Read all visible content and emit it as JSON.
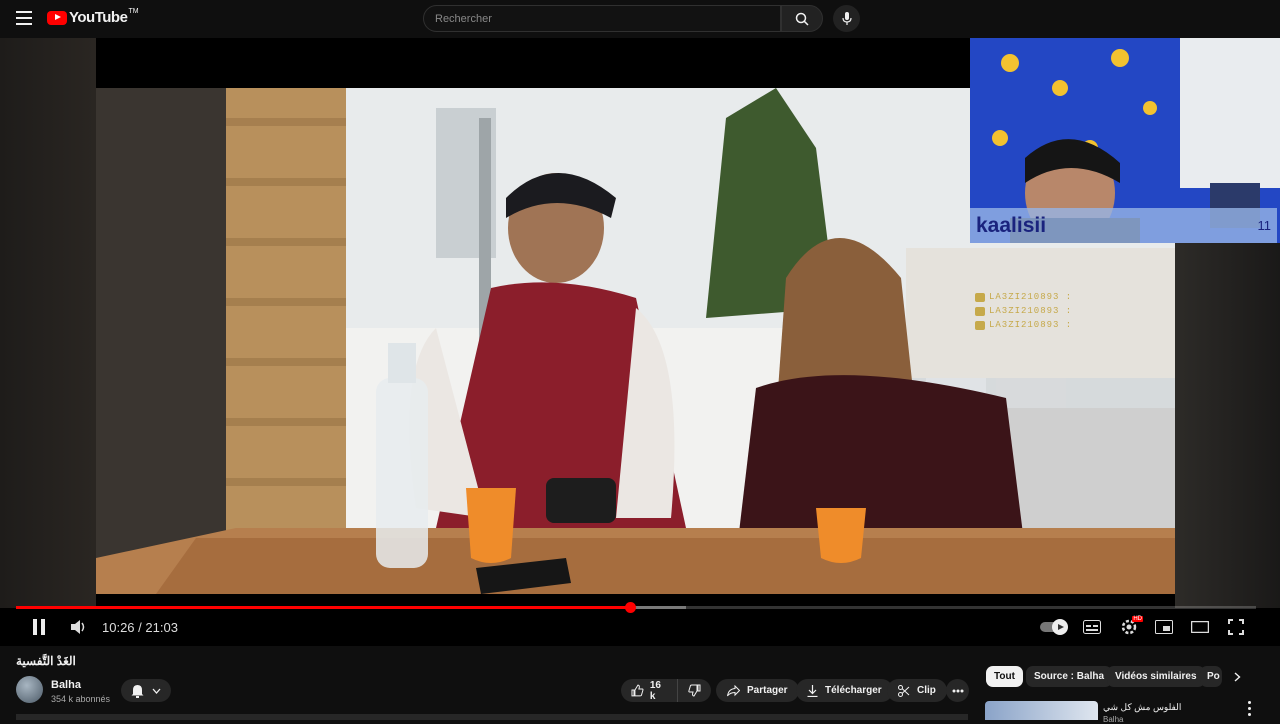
{
  "header": {
    "logo_text": "YouTube",
    "logo_tm": "TM",
    "search_placeholder": "Rechercher"
  },
  "stream_overlay": {
    "streamer_name": "kaalisii",
    "count": "11",
    "chat_lines": [
      "LA3ZI210893 :",
      "LA3ZI210893 :",
      "LA3ZI210893 :"
    ]
  },
  "player": {
    "current_time": "10:26",
    "separator": " / ",
    "duration": "21:03",
    "progress_fraction": 0.495,
    "loaded_fraction": 0.54,
    "hd_badge": "HD"
  },
  "video": {
    "title": "الغَدْ التَّفسية",
    "channel_name": "Balha",
    "subscribers": "354 k abonnés"
  },
  "actions": {
    "likes": "16 k",
    "share_label": "Partager",
    "download_label": "Télécharger",
    "clip_label": "Clip"
  },
  "chips": [
    "Tout",
    "Source : Balha",
    "Vidéos similaires",
    "Po"
  ],
  "recommendation": {
    "title": "الفلوس مش كل شي",
    "channel": "Balha"
  },
  "colors": {
    "accent": "#ff0000",
    "background": "#0f0f0f",
    "surface": "#272727",
    "overlay_band": "#96b4e6",
    "overlay_text": "#1a237e"
  }
}
